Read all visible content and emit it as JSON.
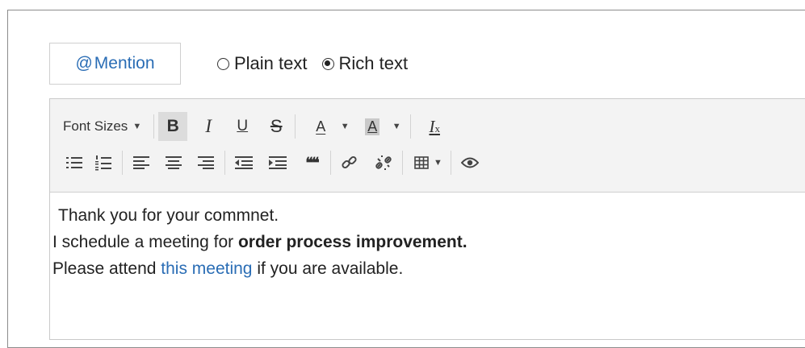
{
  "mention": {
    "at": "@",
    "label": "Mention"
  },
  "format": {
    "options": [
      {
        "label": "Plain text",
        "checked": false
      },
      {
        "label": "Rich text",
        "checked": true
      }
    ]
  },
  "toolbar": {
    "font_sizes_label": "Font Sizes",
    "bold": "B",
    "italic": "I",
    "underline": "U",
    "strike": "S",
    "text_color": "A",
    "bg_color": "A",
    "clear_format": "I",
    "clear_format_sub": "x",
    "blockquote": "❝❝",
    "icons": [
      "bullet-list-icon",
      "numbered-list-icon",
      "align-left-icon",
      "align-center-icon",
      "align-right-icon",
      "outdent-icon",
      "indent-icon",
      "blockquote-icon",
      "link-icon",
      "unlink-icon",
      "table-icon",
      "preview-icon"
    ]
  },
  "content": {
    "line1": "Thank you for your commnet.",
    "line2_prefix": "I schedule a meeting for ",
    "line2_bold": "order process improvement.",
    "line3_prefix": "Please attend ",
    "line3_link": "this meeting",
    "line3_suffix": " if you are available."
  },
  "colors": {
    "link": "#2a6db5",
    "toolbar_bg": "#f3f3f3",
    "active_button": "#dcdcdc"
  }
}
